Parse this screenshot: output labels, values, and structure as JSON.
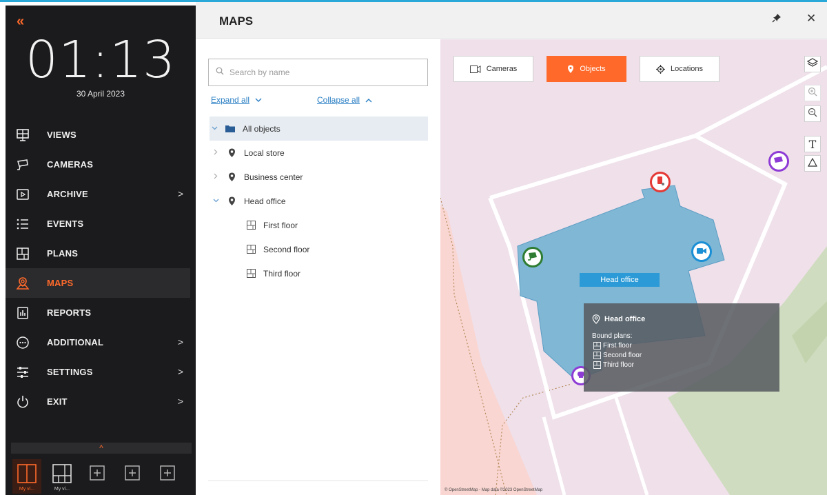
{
  "sidebar": {
    "collapse_glyph": "«",
    "time": "01:13",
    "date": "30 April 2023",
    "accent_color": "#ff6a2b",
    "items": [
      {
        "label": "VIEWS",
        "icon": "views-icon",
        "has_arrow": false
      },
      {
        "label": "CAMERAS",
        "icon": "camera-icon",
        "has_arrow": false
      },
      {
        "label": "ARCHIVE",
        "icon": "archive-icon",
        "has_arrow": true
      },
      {
        "label": "EVENTS",
        "icon": "events-icon",
        "has_arrow": false
      },
      {
        "label": "PLANS",
        "icon": "plans-icon",
        "has_arrow": false
      },
      {
        "label": "MAPS",
        "icon": "maps-icon",
        "has_arrow": false,
        "active": true
      },
      {
        "label": "REPORTS",
        "icon": "reports-icon",
        "has_arrow": false
      },
      {
        "label": "ADDITIONAL",
        "icon": "additional-icon",
        "has_arrow": true
      },
      {
        "label": "SETTINGS",
        "icon": "settings-icon",
        "has_arrow": true
      },
      {
        "label": "EXIT",
        "icon": "power-icon",
        "has_arrow": true
      }
    ],
    "arrow_glyph": ">",
    "expand_glyph": "^",
    "layouts": [
      {
        "label": "My vi...",
        "icon": "layout-split-icon",
        "active": true
      },
      {
        "label": "My vi...",
        "icon": "layout-grid-icon",
        "active": false
      },
      {
        "label": "",
        "icon": "add-layout-icon",
        "active": false
      },
      {
        "label": "",
        "icon": "add-layout-icon",
        "active": false
      },
      {
        "label": "",
        "icon": "add-layout-icon",
        "active": false
      }
    ]
  },
  "header": {
    "title": "MAPS",
    "close_glyph": "✕"
  },
  "tree": {
    "search_placeholder": "Search by name",
    "expand_all": "Expand all",
    "collapse_all": "Collapse all",
    "items": [
      {
        "label": "All objects",
        "icon": "folder-icon",
        "toggle": "expanded",
        "selected": true
      },
      {
        "label": "Local store",
        "icon": "location-pin-icon",
        "toggle": "collapsed"
      },
      {
        "label": "Business center",
        "icon": "location-pin-icon",
        "toggle": "collapsed"
      },
      {
        "label": "Head office",
        "icon": "location-pin-icon",
        "toggle": "expanded"
      },
      {
        "label": "First floor",
        "icon": "plan-icon",
        "toggle": "none"
      },
      {
        "label": "Second floor",
        "icon": "plan-icon",
        "toggle": "none"
      },
      {
        "label": "Third floor",
        "icon": "plan-icon",
        "toggle": "none"
      }
    ]
  },
  "map": {
    "filters": [
      {
        "label": "Cameras",
        "icon": "camera-filter-icon",
        "active": false
      },
      {
        "label": "Objects",
        "icon": "location-pin-icon",
        "active": true
      },
      {
        "label": "Locations",
        "icon": "crosshair-icon",
        "active": false
      }
    ],
    "tools": [
      {
        "name": "layers-icon"
      },
      {
        "name": "zoom-in-icon"
      },
      {
        "name": "zoom-out-icon"
      },
      {
        "name": "text-tool-icon",
        "glyph": "T"
      },
      {
        "name": "polygon-tool-icon"
      }
    ],
    "object_label": "Head office",
    "tooltip": {
      "title": "Head office",
      "subtitle": "Bound plans:",
      "plans": [
        "First floor",
        "Second floor",
        "Third floor"
      ]
    },
    "attribution": "© OpenStreetMap - Map data ©2023 OpenStreetMap",
    "colors": {
      "building": "#7fb7d4",
      "background": "#efe0ea",
      "park": "#cfdcbf",
      "red_area": "#f9d6d2",
      "marker_green": "#2e7d32",
      "marker_blue": "#1a8fd6",
      "marker_red": "#e53935",
      "marker_purple": "#8e3bd6"
    }
  }
}
